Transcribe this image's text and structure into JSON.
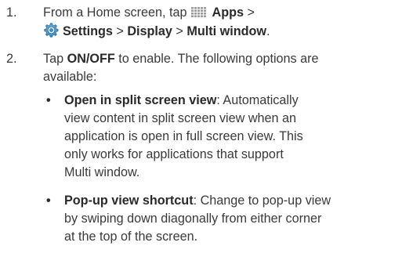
{
  "step1": {
    "number": "1.",
    "line1_prefix": "From a Home screen, tap",
    "apps_label": "Apps",
    "sep1": " >",
    "settings_label": "Settings",
    "sep2": " > ",
    "display_label": "Display",
    "sep3": " > ",
    "multiwindow_label": "Multi window",
    "end": ".",
    "icons": [
      "apps-grid-icon",
      "settings-gear-icon"
    ]
  },
  "step2": {
    "number": "2.",
    "prefix": "Tap ",
    "onoff_label": "ON/OFF",
    "line1_suffix": " to enable. The following options are",
    "line2": "available:"
  },
  "bullets": [
    {
      "term": "Open in split screen view",
      "line1_rest": ": Automatically",
      "lines": [
        "view content in split screen view when an",
        "application is open in full screen view. This",
        "only works for applications that support",
        "Multi window."
      ]
    },
    {
      "term": "Pop-up view shortcut",
      "line1_rest": ": Change to pop-up view",
      "lines": [
        "by swiping down diagonally from either corner",
        "at the top of the screen."
      ]
    }
  ]
}
